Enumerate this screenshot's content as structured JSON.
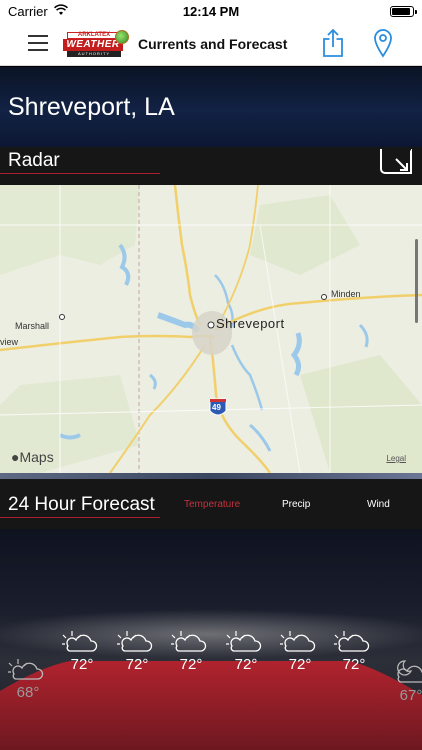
{
  "status_bar": {
    "carrier": "Carrier",
    "time": "12:14 PM"
  },
  "nav": {
    "title": "Currents and Forecast"
  },
  "logo": {
    "top_text": "ARKLATEX",
    "main_text": "WEATHER",
    "bottom_text": "AUTHORITY"
  },
  "location": {
    "city": "Shreveport, LA"
  },
  "radar": {
    "title": "Radar",
    "map_labels": {
      "shreveport": "Shreveport",
      "marshall": "Marshall",
      "minden": "Minden",
      "longview_partial": "view",
      "interstate": "49"
    },
    "maps_brand": "Maps",
    "legal": "Legal"
  },
  "forecast": {
    "title": "24 Hour Forecast",
    "tabs": [
      {
        "label": "Temperature",
        "active": true
      },
      {
        "label": "Precip",
        "active": false
      },
      {
        "label": "Wind",
        "active": false
      }
    ],
    "hours": [
      {
        "temp": "68°",
        "icon": "partly-cloudy-icon"
      },
      {
        "temp": "72°",
        "icon": "partly-cloudy-icon"
      },
      {
        "temp": "72°",
        "icon": "partly-cloudy-icon"
      },
      {
        "temp": "72°",
        "icon": "partly-cloudy-icon"
      },
      {
        "temp": "72°",
        "icon": "partly-cloudy-icon"
      },
      {
        "temp": "72°",
        "icon": "partly-cloudy-icon"
      },
      {
        "temp": "72°",
        "icon": "partly-cloudy-icon"
      },
      {
        "temp": "67°",
        "icon": "partly-cloudy-night-icon"
      }
    ]
  },
  "colors": {
    "accent_red": "#c6343c",
    "temp_fill": "#a3222c"
  }
}
